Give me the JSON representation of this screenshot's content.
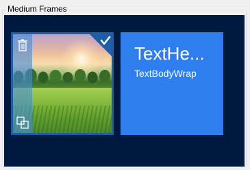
{
  "group": {
    "title": "Medium Frames"
  },
  "tiles": {
    "photo": {
      "selected": true,
      "icons": {
        "delete": "trash-icon",
        "duplicate": "duplicate-icon",
        "selected": "checkmark-icon"
      }
    },
    "text": {
      "heading": "TextHe...",
      "body": "TextBodyWrap"
    }
  },
  "colors": {
    "canvas": "#001a3f",
    "photo_tile_border": "#1e5da8",
    "text_tile": "#2e7ef0",
    "toolbar_overlay": "#468cdc"
  }
}
